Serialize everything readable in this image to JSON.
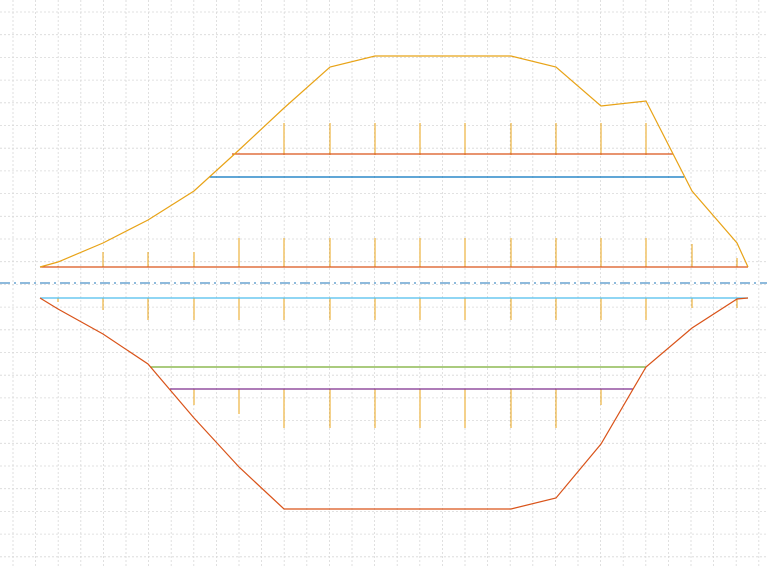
{
  "diagram": {
    "colors": {
      "background": "#ffffff",
      "grid": "#d8d8d8",
      "centerline": "#4a90c8",
      "upper_outline": "#e8a317",
      "upper_ticks": "#e8a317",
      "lower_outline": "#d95319",
      "lower_ticks": "#e8a317",
      "line_red_top": "#d95319",
      "line_blue": "#0072bd",
      "line_red_base": "#d95319",
      "line_cyan": "#4dbeee",
      "line_green": "#77ac30",
      "line_purple": "#7e2f8e"
    }
  }
}
